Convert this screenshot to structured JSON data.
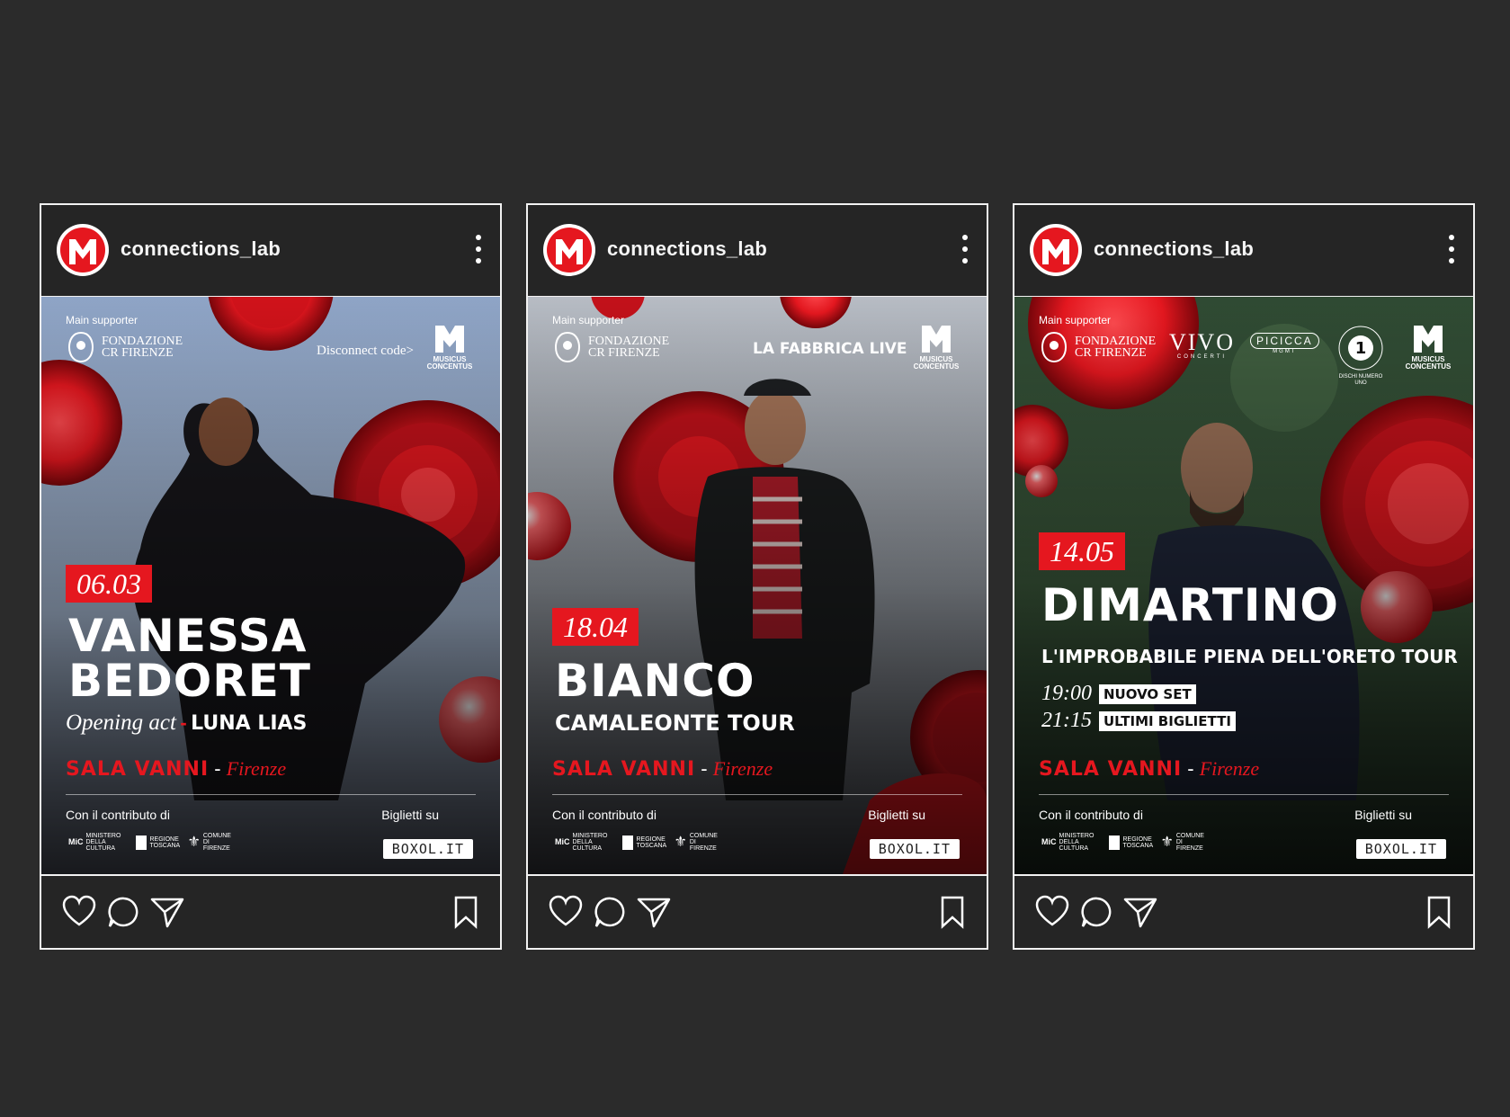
{
  "colors": {
    "background": "#2b2b2b",
    "accent": "#e5171f",
    "frame": "#f2f2f2"
  },
  "posts": [
    {
      "username": "connections_lab",
      "main_supporter": "Main supporter",
      "fondazione_line1": "FONDAZIONE",
      "fondazione_line2": "CR FIRENZE",
      "partner": "Disconnect code>",
      "musicus_line1": "MUSICUS",
      "musicus_line2": "CONCENTUS",
      "date": "06.03",
      "title_line1": "VANESSA",
      "title_line2": "BEDORET",
      "opening_label": "Opening act",
      "opening_artist": "LUNA LIAS",
      "venue": "SALA VANNI",
      "venue_sep": "-",
      "city": "Firenze",
      "contrib": "Con il contributo di",
      "tickets": "Biglietti su",
      "boxol": "BOXOL.IT"
    },
    {
      "username": "connections_lab",
      "main_supporter": "Main supporter",
      "fondazione_line1": "FONDAZIONE",
      "fondazione_line2": "CR FIRENZE",
      "partner": "LA FABBRICA LIVE",
      "musicus_line1": "MUSICUS",
      "musicus_line2": "CONCENTUS",
      "date": "18.04",
      "title_line1": "BIANCO",
      "subtitle": "CAMALEONTE TOUR",
      "venue": "SALA VANNI",
      "venue_sep": "-",
      "city": "Firenze",
      "contrib": "Con il contributo di",
      "tickets": "Biglietti su",
      "boxol": "BOXOL.IT"
    },
    {
      "username": "connections_lab",
      "main_supporter": "Main supporter",
      "fondazione_line1": "FONDAZIONE",
      "fondazione_line2": "CR FIRENZE",
      "partner1": "VIVO",
      "partner1_sub": "CONCERTI",
      "partner2": "PICICCA",
      "partner2_sub": "MGMT",
      "partner3": "DISCHI NUMERO UNO",
      "musicus_line1": "MUSICUS",
      "musicus_line2": "CONCENTUS",
      "date": "14.05",
      "title_line1": "DIMARTINO",
      "subtitle": "L'IMPROBABILE PIENA DELL'ORETO TOUR",
      "time1": "19:00",
      "chip1": "NUOVO SET",
      "time2": "21:15",
      "chip2": "ULTIMI BIGLIETTI",
      "venue": "SALA VANNI",
      "venue_sep": "-",
      "city": "Firenze",
      "contrib": "Con il contributo di",
      "tickets": "Biglietti su",
      "boxol": "BOXOL.IT"
    }
  ],
  "sponsors": {
    "ministero": "MINISTERO DELLA CULTURA",
    "mic": "MiC",
    "regione": "REGIONE TOSCANA",
    "comune": "COMUNE DI FIRENZE"
  },
  "icons": [
    "heart-icon",
    "comment-icon",
    "share-icon",
    "bookmark-icon",
    "more-options-icon"
  ]
}
